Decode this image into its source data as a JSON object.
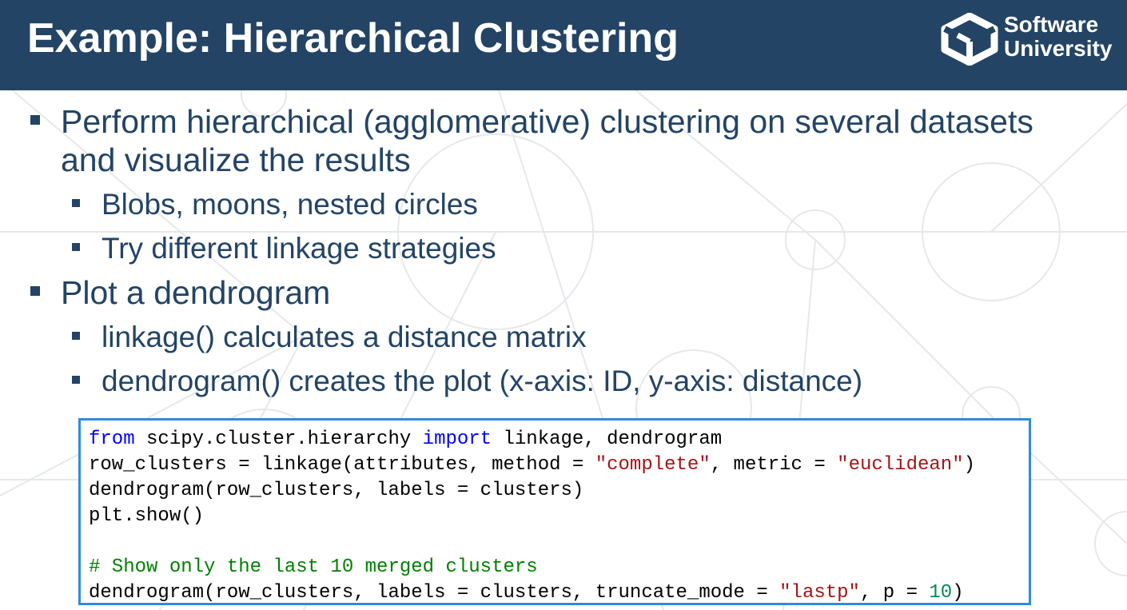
{
  "header": {
    "title": "Example: Hierarchical Clustering",
    "logo_line1": "Software",
    "logo_line2": "University",
    "background_color": "#234465"
  },
  "bullets": [
    {
      "level": 1,
      "lines": [
        "Perform hierarchical (agglomerative) clustering on several datasets",
        "and visualize the results"
      ]
    },
    {
      "level": 2,
      "text": "Blobs, moons, nested circles"
    },
    {
      "level": 2,
      "text": "Try different linkage strategies"
    },
    {
      "level": 1,
      "text": "Plot a dendrogram"
    },
    {
      "level": 2,
      "text": "linkage() calculates a distance matrix"
    },
    {
      "level": 2,
      "text": "dendrogram() creates the plot (x-axis: ID, y-axis: distance)"
    }
  ],
  "code": {
    "border_color": "#2f8be0",
    "line1": {
      "kw1": "from",
      "t1": " scipy.cluster.hierarchy ",
      "kw2": "import",
      "t2": " linkage, dendrogram"
    },
    "line2": {
      "t1": "row_clusters = linkage(attributes, method = ",
      "s1": "\"complete\"",
      "t2": ", metric = ",
      "s2": "\"euclidean\"",
      "t3": ")"
    },
    "line3": "dendrogram(row_clusters, labels = clusters)",
    "line4": "plt.show()",
    "line6": "# Show only the last 10 merged clusters",
    "line7": {
      "t1": "dendrogram(row_clusters, labels = clusters, truncate_mode = ",
      "s1": "\"lastp\"",
      "t2": ", p = ",
      "n1": "10",
      "t3": ")"
    }
  }
}
